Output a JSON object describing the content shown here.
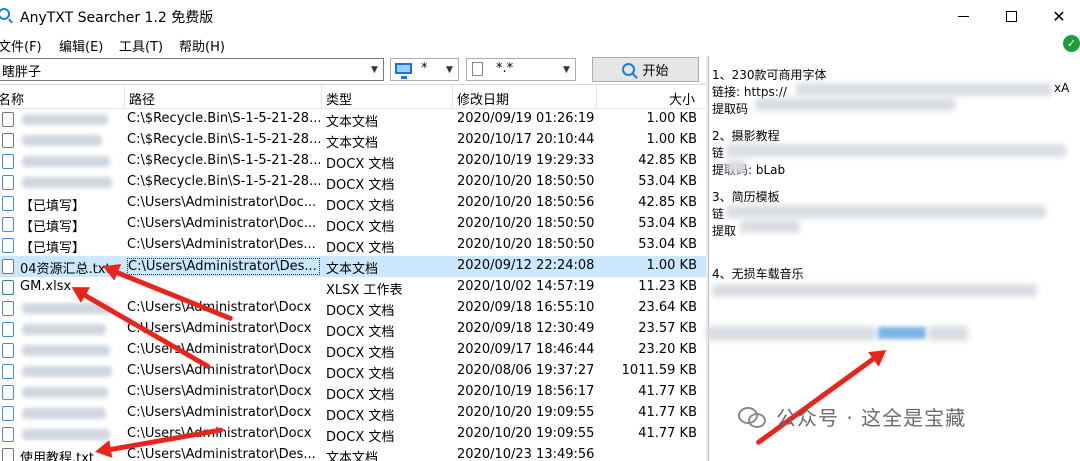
{
  "window": {
    "title": "AnyTXT Searcher 1.2 免费版"
  },
  "menu": [
    "文件(F)",
    "编辑(E)",
    "工具(T)",
    "帮助(H)"
  ],
  "toolbar": {
    "search_value": "瞎胖子",
    "drive_value": "*",
    "ext_value": "*.*",
    "start_label": "开始"
  },
  "columns": {
    "name": "名称",
    "path": "路径",
    "type": "类型",
    "date": "修改日期",
    "size": "大小"
  },
  "rows": [
    {
      "name": "",
      "path": "C:\\$Recycle.Bin\\S-1-5-21-28...",
      "type": "文本文档",
      "date": "2020/09/19   01:26:19",
      "size": "1.00 KB",
      "icon": "txt"
    },
    {
      "name": "",
      "path": "C:\\$Recycle.Bin\\S-1-5-21-28...",
      "type": "文本文档",
      "date": "2020/10/17   20:10:44",
      "size": "1.00 KB",
      "icon": "txt"
    },
    {
      "name": "",
      "path": "C:\\$Recycle.Bin\\S-1-5-21-28...",
      "type": "DOCX 文档",
      "date": "2020/10/19   19:29:33",
      "size": "42.85 KB",
      "icon": "doc"
    },
    {
      "name": "",
      "path": "C:\\$Recycle.Bin\\S-1-5-21-28...",
      "type": "DOCX 文档",
      "date": "2020/10/20   18:50:50",
      "size": "53.04 KB",
      "icon": "doc"
    },
    {
      "name": "【已填写】",
      "path": "C:\\Users\\Administrator\\Doc...",
      "type": "DOCX 文档",
      "date": "2020/10/20   18:50:56",
      "size": "42.85 KB",
      "icon": "doc"
    },
    {
      "name": "【已填写】",
      "path": "C:\\Users\\Administrator\\Doc...",
      "type": "DOCX 文档",
      "date": "2020/10/20   18:50:50",
      "size": "53.04 KB",
      "icon": "doc"
    },
    {
      "name": "【已填写】",
      "path": "C:\\Users\\Administrator\\Des...",
      "type": "DOCX 文档",
      "date": "2020/10/20   18:50:50",
      "size": "53.04 KB",
      "icon": "doc"
    },
    {
      "name": "04资源汇总.txt",
      "path": "C:\\Users\\Administrator\\Des...",
      "type": "文本文档",
      "date": "2020/09/12   22:24:08",
      "size": "1.00 KB",
      "icon": "txt",
      "selected": true
    },
    {
      "name": "GM.xlsx",
      "path": "",
      "type": "XLSX 工作表",
      "date": "2020/10/02   14:57:19",
      "size": "11.23 KB",
      "icon": "xls"
    },
    {
      "name": "",
      "path": "C:\\Users\\Administrator\\Docx",
      "type": "DOCX 文档",
      "date": "2020/09/18   16:55:10",
      "size": "23.64 KB",
      "icon": "doc"
    },
    {
      "name": "",
      "path": "C:\\Users\\Administrator\\Docx",
      "type": "DOCX 文档",
      "date": "2020/09/18   12:30:49",
      "size": "23.57 KB",
      "icon": "doc"
    },
    {
      "name": "",
      "path": "C:\\Users\\Administrator\\Docx",
      "type": "DOCX 文档",
      "date": "2020/09/17   18:46:44",
      "size": "23.20 KB",
      "icon": "doc"
    },
    {
      "name": "",
      "path": "C:\\Users\\Administrator\\Docx",
      "type": "DOCX 文档",
      "date": "2020/08/06   19:37:27",
      "size": "1011.59 KB",
      "icon": "doc"
    },
    {
      "name": "",
      "path": "C:\\Users\\Administrator\\Docx",
      "type": "DOCX 文档",
      "date": "2020/10/19   18:56:17",
      "size": "41.77 KB",
      "icon": "doc"
    },
    {
      "name": "",
      "path": "C:\\Users\\Administrator\\Docx",
      "type": "DOCX 文档",
      "date": "2020/10/20   19:09:55",
      "size": "41.77 KB",
      "icon": "doc"
    },
    {
      "name": "",
      "path": "C:\\Users\\Administrator\\Docx",
      "type": "DOCX 文档",
      "date": "2020/10/20   19:09:55",
      "size": "41.77 KB",
      "icon": "doc"
    },
    {
      "name": "使用教程.txt",
      "path": "C:\\Users\\Administrator\\Des...",
      "type": "文本文档",
      "date": "2020/10/23   13:49:56",
      "size": "",
      "icon": "txt"
    }
  ],
  "preview": {
    "s1_title": "1、230款可商用字体",
    "s1_link": "链接: https://",
    "s1_link_end": "xA",
    "s1_code": "提取码",
    "s2_title": "2、摄影教程",
    "s2_link": "链",
    "s2_code": "提取码: bLab",
    "s3_title": "3、简历模板",
    "s3_link": "链",
    "s3_code": "提取",
    "s4_title": "4、无损车载音乐"
  },
  "watermark": {
    "text": "公众号 · 这全是宝藏"
  },
  "colors": {
    "accent": "#1f7bd8",
    "selection": "#cce8ff",
    "annotation": "#e8251c"
  }
}
